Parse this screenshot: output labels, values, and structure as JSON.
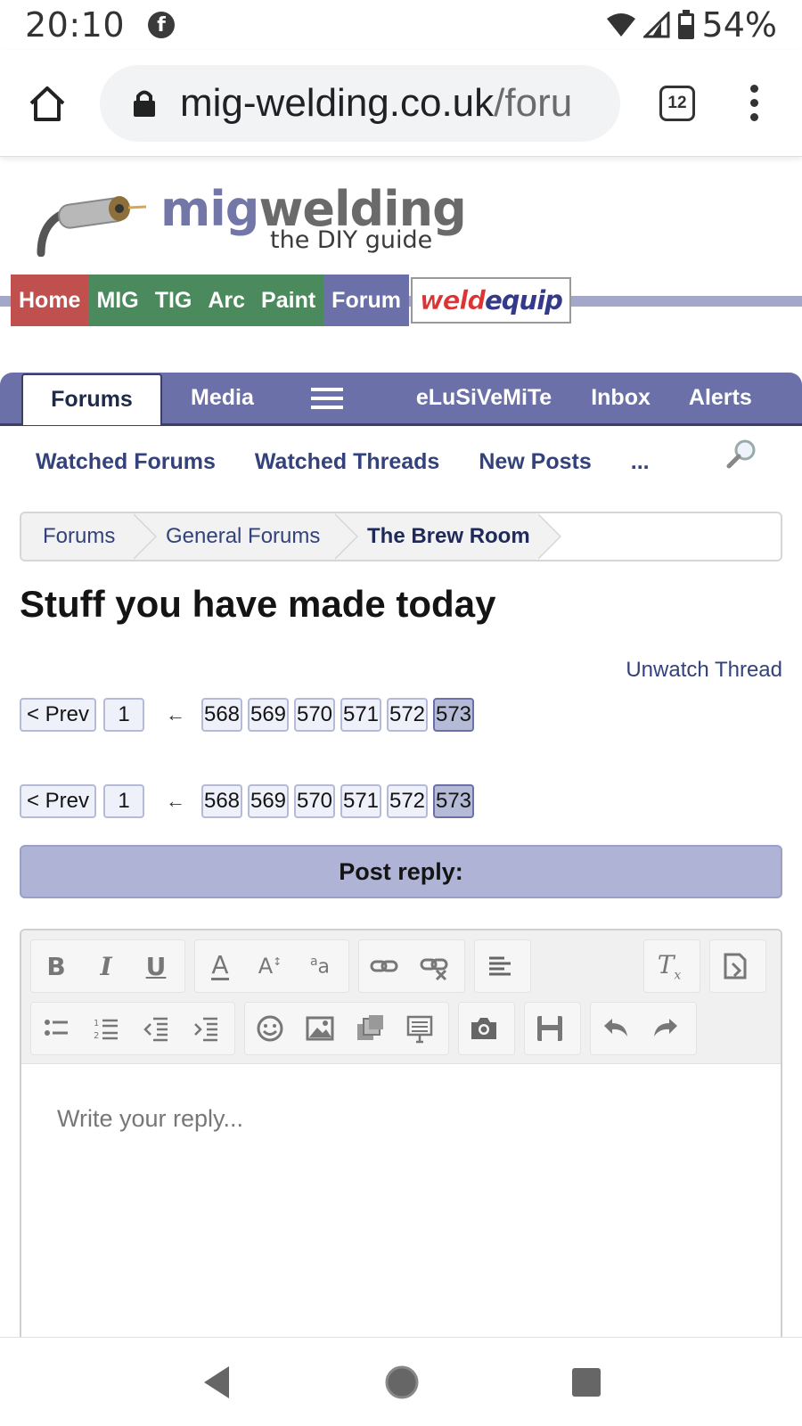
{
  "status_bar": {
    "time": "20:10",
    "battery": "54%",
    "icons": [
      "facebook-icon",
      "wifi-icon",
      "signal-icon",
      "battery-icon"
    ]
  },
  "browser": {
    "url_host": "mig-welding.co.uk",
    "url_path": "/foru",
    "tab_count": "12"
  },
  "logo": {
    "mig": "mig",
    "welding": "welding",
    "tagline": "the DIY guide"
  },
  "site_nav": {
    "items": [
      "Home",
      "MIG",
      "TIG",
      "Arc",
      "Paint",
      "Forum"
    ],
    "weldequip_weld": "weld",
    "weldequip_equip": "equip",
    "colors": {
      "home": "#c0504d",
      "green": "#4a8a5c",
      "forum": "#6b71a8"
    }
  },
  "forum_tabs": {
    "forums": "Forums",
    "media": "Media",
    "user": "eLuSiVeMiTe",
    "inbox": "Inbox",
    "alerts": "Alerts"
  },
  "sub_nav": {
    "watched_forums": "Watched Forums",
    "watched_threads": "Watched Threads",
    "new_posts": "New Posts",
    "more": "..."
  },
  "breadcrumb": [
    "Forums",
    "General Forums",
    "The Brew Room"
  ],
  "thread": {
    "title": "Stuff you have made today",
    "unwatch": "Unwatch Thread"
  },
  "pagination": {
    "prev": "< Prev",
    "first": "1",
    "ellipsis": "←",
    "pages": [
      "568",
      "569",
      "570",
      "571",
      "572",
      "573"
    ],
    "current": "573"
  },
  "reply": {
    "header": "Post reply:",
    "placeholder": "Write your reply..."
  }
}
